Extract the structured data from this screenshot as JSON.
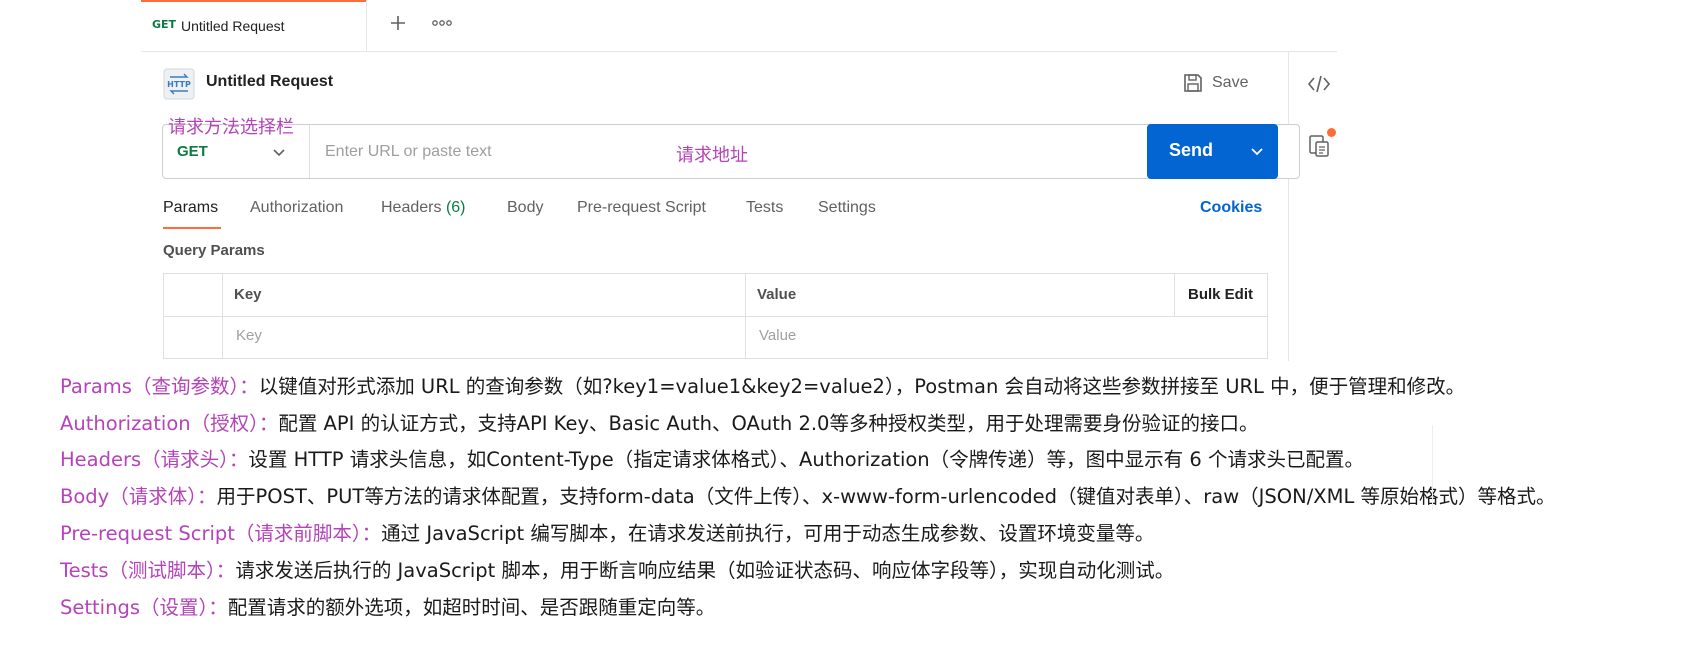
{
  "tab": {
    "method": "GET",
    "title": "Untitled Request"
  },
  "request": {
    "title": "Untitled Request",
    "save_label": "Save",
    "method": "GET",
    "url_placeholder": "Enter URL or paste text",
    "send_label": "Send"
  },
  "annotations": {
    "method_selector": "请求方法选择栏",
    "url": "请求地址"
  },
  "request_tabs": [
    {
      "label": "Params"
    },
    {
      "label": "Authorization"
    },
    {
      "label": "Headers",
      "count": "(6)"
    },
    {
      "label": "Body"
    },
    {
      "label": "Pre-request Script"
    },
    {
      "label": "Tests"
    },
    {
      "label": "Settings"
    }
  ],
  "cookies_label": "Cookies",
  "query_params": {
    "title": "Query Params",
    "columns": {
      "key": "Key",
      "value": "Value"
    },
    "bulk_edit": "Bulk Edit",
    "key_placeholder": "Key",
    "value_placeholder": "Value"
  },
  "descriptions": [
    {
      "term": "Params（查询参数）：",
      "text": "以键值对形式添加 URL 的查询参数（如?key1=value1&key2=value2），Postman 会自动将这些参数拼接至 URL 中，便于管理和修改。"
    },
    {
      "term": "Authorization（授权）：",
      "text": "配置 API 的认证方式，支持API Key、Basic Auth、OAuth 2.0等多种授权类型，用于处理需要身份验证的接口。"
    },
    {
      "term": "Headers（请求头）：",
      "text": "设置 HTTP 请求头信息，如Content-Type（指定请求体格式）、Authorization（令牌传递）等，图中显示有 6 个请求头已配置。"
    },
    {
      "term": "Body（请求体）：",
      "text": "用于POST、PUT等方法的请求体配置，支持form-data（文件上传）、x-www-form-urlencoded（键值对表单）、raw（JSON/XML 等原始格式）等格式。"
    },
    {
      "term": "Pre-request Script（请求前脚本）：",
      "text": "通过 JavaScript 编写脚本，在请求发送前执行，可用于动态生成参数、设置环境变量等。"
    },
    {
      "term": "Tests（测试脚本）：",
      "text": "请求发送后执行的 JavaScript 脚本，用于断言响应结果（如验证状态码、响应体字段等），实现自动化测试。"
    },
    {
      "term": "Settings（设置）：",
      "text": "配置请求的额外选项，如超时时间、是否跟随重定向等。"
    }
  ],
  "colors": {
    "accent_orange": "#ff6c37",
    "send_blue": "#0265d2",
    "method_green": "#0c7a43",
    "annotation_purple": "#b543b9"
  },
  "icons": [
    "http-request-icon",
    "save-icon",
    "code-icon",
    "documentation-icon",
    "plus-icon",
    "more-icon",
    "chevron-down-icon"
  ]
}
